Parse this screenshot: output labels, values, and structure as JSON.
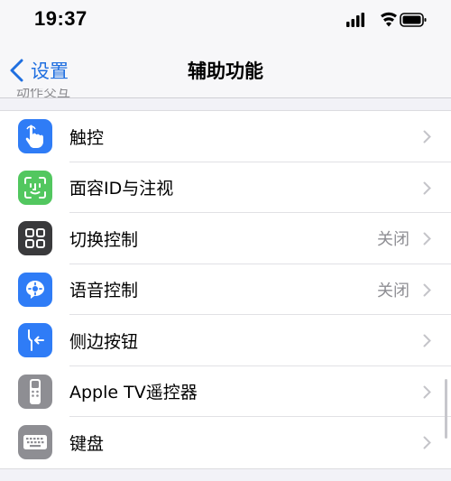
{
  "status": {
    "time": "19:37"
  },
  "nav": {
    "back_label": "设置",
    "title": "辅助功能"
  },
  "section_header": "动作交互",
  "rows": [
    {
      "label": "触控",
      "value": "",
      "icon": "touch-hand-icon",
      "color": "#2f7cf6"
    },
    {
      "label": "面容ID与注视",
      "value": "",
      "icon": "face-id-icon",
      "color": "#52c75f"
    },
    {
      "label": "切换控制",
      "value": "关闭",
      "icon": "switch-control-icon",
      "color": "#3a3a3c"
    },
    {
      "label": "语音控制",
      "value": "关闭",
      "icon": "voice-control-icon",
      "color": "#2f7cf6"
    },
    {
      "label": "侧边按钮",
      "value": "",
      "icon": "side-button-icon",
      "color": "#2f7cf6"
    },
    {
      "label": "Apple TV遥控器",
      "value": "",
      "icon": "tv-remote-icon",
      "color": "#8e8e93"
    },
    {
      "label": "键盘",
      "value": "",
      "icon": "keyboard-icon",
      "color": "#8e8e93"
    }
  ]
}
